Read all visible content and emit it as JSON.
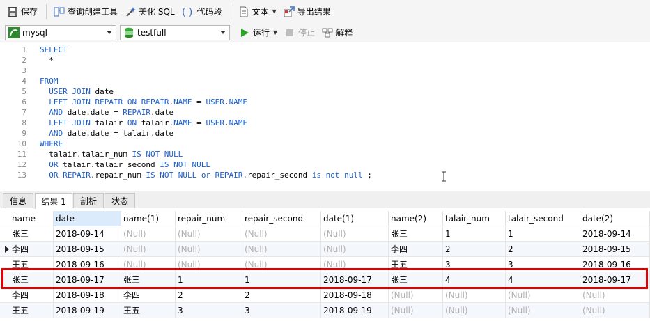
{
  "toolbar": {
    "save": "保存",
    "query_builder": "查询创建工具",
    "beautify_sql": "美化 SQL",
    "code_snippet": "代码段",
    "text": "文本",
    "export_results": "导出结果"
  },
  "toolbar2": {
    "connection": "mysql",
    "database": "testfull",
    "run": "运行",
    "stop": "停止",
    "explain": "解释"
  },
  "editor": {
    "lines": [
      {
        "n": "1",
        "tokens": [
          {
            "t": "SELECT",
            "k": true
          }
        ]
      },
      {
        "n": "2",
        "tokens": [
          {
            "t": "  *",
            "k": false
          }
        ]
      },
      {
        "n": "3",
        "tokens": []
      },
      {
        "n": "4",
        "tokens": [
          {
            "t": "FROM",
            "k": true
          }
        ]
      },
      {
        "n": "5",
        "tokens": [
          {
            "t": "  ",
            "k": false
          },
          {
            "t": "USER",
            "k": true
          },
          {
            "t": " ",
            "k": false
          },
          {
            "t": "JOIN",
            "k": true
          },
          {
            "t": " date",
            "k": false
          }
        ]
      },
      {
        "n": "6",
        "tokens": [
          {
            "t": "  ",
            "k": false
          },
          {
            "t": "LEFT JOIN REPAIR ON REPAIR",
            "k": true
          },
          {
            "t": ".",
            "k": false
          },
          {
            "t": "NAME",
            "k": true
          },
          {
            "t": " = ",
            "k": false
          },
          {
            "t": "USER",
            "k": true
          },
          {
            "t": ".",
            "k": false
          },
          {
            "t": "NAME",
            "k": true
          }
        ]
      },
      {
        "n": "7",
        "tokens": [
          {
            "t": "  ",
            "k": false
          },
          {
            "t": "AND",
            "k": true
          },
          {
            "t": " date.date = ",
            "k": false
          },
          {
            "t": "REPAIR",
            "k": true
          },
          {
            "t": ".date",
            "k": false
          }
        ]
      },
      {
        "n": "8",
        "tokens": [
          {
            "t": "  ",
            "k": false
          },
          {
            "t": "LEFT JOIN",
            "k": true
          },
          {
            "t": " talair ",
            "k": false
          },
          {
            "t": "ON",
            "k": true
          },
          {
            "t": " talair.",
            "k": false
          },
          {
            "t": "NAME",
            "k": true
          },
          {
            "t": " = ",
            "k": false
          },
          {
            "t": "USER",
            "k": true
          },
          {
            "t": ".",
            "k": false
          },
          {
            "t": "NAME",
            "k": true
          }
        ]
      },
      {
        "n": "9",
        "tokens": [
          {
            "t": "  ",
            "k": false
          },
          {
            "t": "AND",
            "k": true
          },
          {
            "t": " date.date = talair.date",
            "k": false
          }
        ]
      },
      {
        "n": "10",
        "tokens": [
          {
            "t": "WHERE",
            "k": true
          }
        ]
      },
      {
        "n": "11",
        "tokens": [
          {
            "t": "  talair.talair_num ",
            "k": false
          },
          {
            "t": "IS NOT NULL",
            "k": true
          }
        ]
      },
      {
        "n": "12",
        "tokens": [
          {
            "t": "  ",
            "k": false
          },
          {
            "t": "OR",
            "k": true
          },
          {
            "t": " talair.talair_second ",
            "k": false
          },
          {
            "t": "IS NOT NULL",
            "k": true
          }
        ]
      },
      {
        "n": "13",
        "tokens": [
          {
            "t": "  ",
            "k": false
          },
          {
            "t": "OR REPAIR",
            "k": true
          },
          {
            "t": ".repair_num ",
            "k": false
          },
          {
            "t": "IS NOT NULL or REPAIR",
            "k": true
          },
          {
            "t": ".repair_second ",
            "k": false
          },
          {
            "t": "is not null",
            "k": true
          },
          {
            "t": " ;",
            "k": false
          }
        ]
      }
    ]
  },
  "tabs": [
    "信息",
    "结果 1",
    "剖析",
    "状态"
  ],
  "grid": {
    "columns": [
      "name",
      "date",
      "name(1)",
      "repair_num",
      "repair_second",
      "date(1)",
      "name(2)",
      "talair_num",
      "talair_second",
      "date(2)"
    ],
    "rows": [
      [
        "张三",
        "2018-09-14",
        "(Null)",
        "(Null)",
        "(Null)",
        "(Null)",
        "张三",
        "1",
        "1",
        "2018-09-14"
      ],
      [
        "李四",
        "2018-09-15",
        "(Null)",
        "(Null)",
        "(Null)",
        "(Null)",
        "李四",
        "2",
        "2",
        "2018-09-15"
      ],
      [
        "王五",
        "2018-09-16",
        "(Null)",
        "(Null)",
        "(Null)",
        "(Null)",
        "王五",
        "3",
        "3",
        "2018-09-16"
      ],
      [
        "张三",
        "2018-09-17",
        "张三",
        "1",
        "1",
        "2018-09-17",
        "张三",
        "4",
        "4",
        "2018-09-17"
      ],
      [
        "李四",
        "2018-09-18",
        "李四",
        "2",
        "2",
        "2018-09-18",
        "(Null)",
        "(Null)",
        "(Null)",
        "(Null)"
      ],
      [
        "王五",
        "2018-09-19",
        "王五",
        "3",
        "3",
        "2018-09-19",
        "(Null)",
        "(Null)",
        "(Null)",
        "(Null)"
      ]
    ],
    "null_color": "#b0b0b0"
  },
  "colors": {
    "keyword": "#1a5fd0",
    "highlight_border": "#e00000",
    "run_icon": "#2aa52a"
  }
}
